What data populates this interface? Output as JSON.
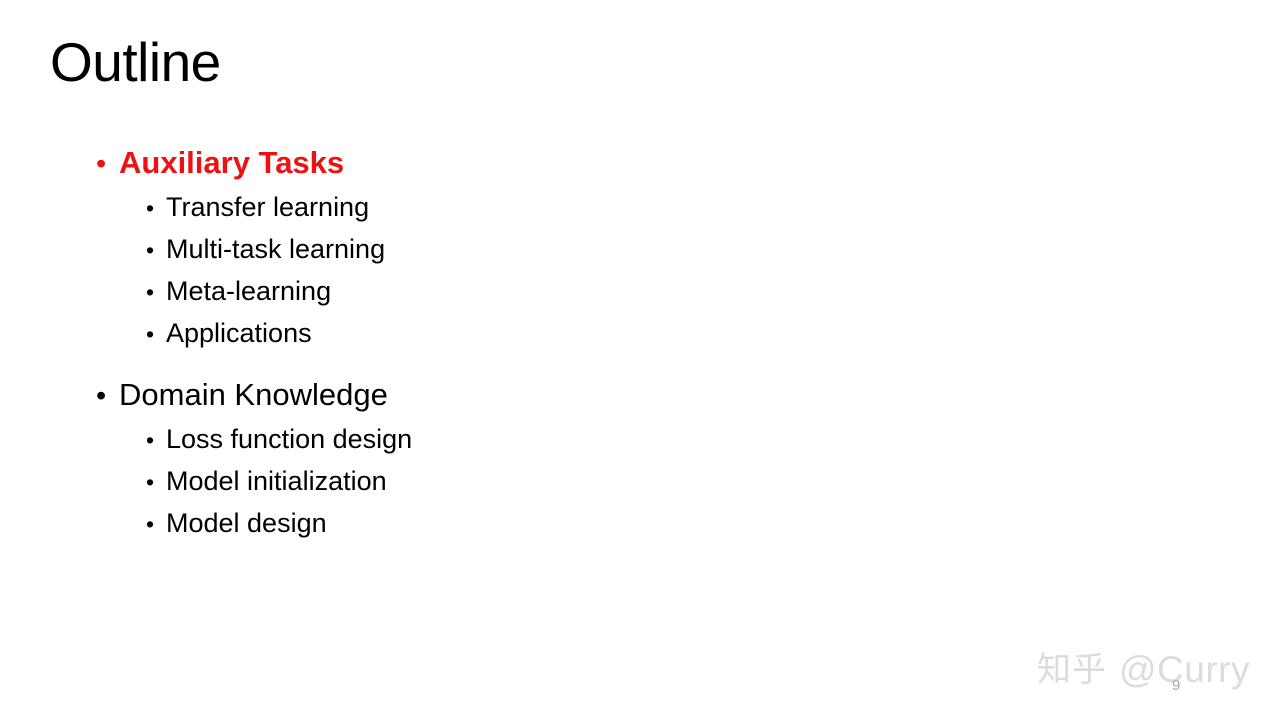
{
  "slide": {
    "title": "Outline",
    "page_number": "9",
    "background_color": "#ffffff",
    "accent_color": "#ee1111",
    "text_color": "#000000"
  },
  "outline": {
    "bullet_glyph": "•",
    "groups": [
      {
        "heading": {
          "label": "Auxiliary Tasks",
          "accent": true
        },
        "items": [
          {
            "label": "Transfer learning"
          },
          {
            "label": "Multi-task learning"
          },
          {
            "label": "Meta-learning"
          },
          {
            "label": "Applications"
          }
        ]
      },
      {
        "heading": {
          "label": "Domain Knowledge",
          "accent": false
        },
        "items": [
          {
            "label": "Loss function design"
          },
          {
            "label": "Model initialization"
          },
          {
            "label": "Model design"
          }
        ]
      }
    ]
  },
  "watermark": {
    "logo": "知乎",
    "handle": "@Curry",
    "color": "#dcdcdc"
  }
}
